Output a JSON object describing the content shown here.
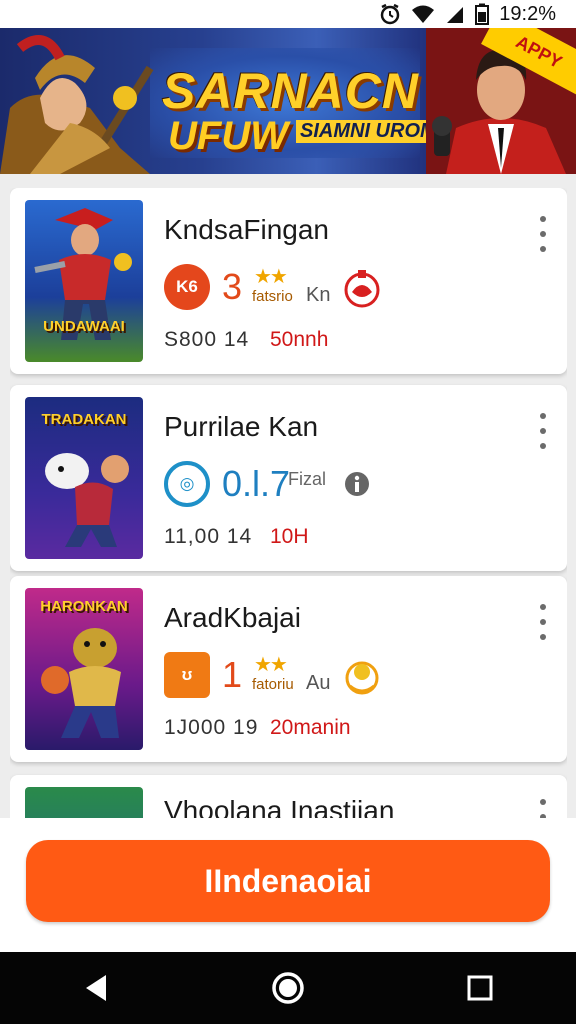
{
  "status_bar": {
    "time": "19:2%",
    "icons": [
      "alarm-icon",
      "wifi-icon",
      "signal-icon",
      "battery-icon"
    ]
  },
  "banner": {
    "title_line1": "SARNACN",
    "title_line2": "UFUW",
    "title_line3": "SIAMNI UROMAKO",
    "corner_tag": "APPY"
  },
  "games": [
    {
      "name": "KndsaFingan",
      "thumb_title": "UNDAWAAI",
      "badge_text": "K6",
      "score": "3",
      "score_label": "fatsrio",
      "unit": "Kn",
      "stat": "S800 14",
      "time": "50nnh",
      "colors": {
        "badge_bg": "#e4471c",
        "badge_fg": "#ffffff",
        "score": "#e24a1a"
      }
    },
    {
      "name": "Purrilae Kan",
      "thumb_title": "TRADAKAN",
      "badge_text": "◎",
      "score": "0.l.7",
      "score_label": "Fizal",
      "unit": "",
      "stat": "11,00 14",
      "time": "10H",
      "colors": {
        "badge_bg": "#1e90c8",
        "badge_fg": "#ffffff",
        "score": "#1e7fc0"
      }
    },
    {
      "name": "AradKbajai",
      "thumb_title": "HARONKAN",
      "badge_text": "ʊ",
      "score": "1",
      "score_label": "fatoriu",
      "unit": "Au",
      "stat": "1J000 19",
      "time": "20manin",
      "colors": {
        "badge_bg": "#f07a14",
        "badge_fg": "#ffffff",
        "score": "#e24a1a"
      }
    },
    {
      "name": "Vhoolana Inastiian",
      "thumb_title": "",
      "badge_text": "",
      "score": "",
      "score_label": "",
      "unit": "",
      "stat": "",
      "time": "",
      "colors": {
        "badge_bg": "#cccccc",
        "badge_fg": "#ffffff",
        "score": "#e24a1a"
      }
    }
  ],
  "cta": {
    "label": "IIndenaoiai",
    "color": "#ff5a14"
  },
  "nav": {
    "icons": [
      "back-icon",
      "home-icon",
      "recents-icon"
    ]
  }
}
